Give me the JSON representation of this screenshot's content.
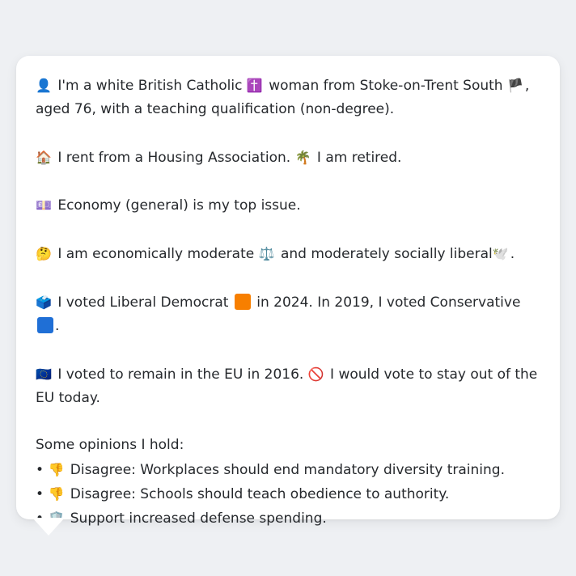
{
  "colors": {
    "background": "#eef0f3",
    "card": "#ffffff",
    "text": "#26292d",
    "lib_dem_square": "#f77f00",
    "conservative_square": "#1f6fd6"
  },
  "icons": [
    "person-icon",
    "cross-icon",
    "england-flag-icon",
    "house-icon",
    "palm-tree-icon",
    "money-icon",
    "thinking-face-icon",
    "scales-icon",
    "dove-icon",
    "ballot-box-icon",
    "orange-square-icon",
    "blue-square-icon",
    "eu-flag-icon",
    "no-entry-icon",
    "thumbs-down-icon",
    "shield-icon"
  ],
  "persona": {
    "intro_emoji": "👤",
    "intro_text_a": "I'm a white British Catholic",
    "religion_emoji": "✝️",
    "intro_text_b": "woman from Stoke-on-Trent South",
    "flag_emoji": "🏴",
    "intro_text_c": ", aged 76, with a teaching qualification (non-degree).",
    "housing_emoji": "🏠",
    "housing_text": "I rent from a Housing Association.",
    "work_emoji": "🌴",
    "work_text": "I am retired.",
    "issue_emoji": "💷",
    "issue_text": "Economy (general) is my top issue.",
    "ideology_emoji": "🤔",
    "ideology_text_a": "I am economically moderate",
    "scales_emoji": "⚖️",
    "ideology_text_b": "and moderately socially liberal",
    "dove_emoji": "🕊️",
    "ideology_text_c": ".",
    "vote_emoji": "🗳️",
    "vote_text_a": "I voted Liberal Democrat",
    "vote_text_b": "in 2024. In 2019, I voted Conservative",
    "vote_text_c": ".",
    "eu_emoji": "🇪🇺",
    "eu_text_a": "I voted to remain in the EU in 2016.",
    "no_entry_emoji": "🚫",
    "eu_text_b": "I would vote to stay out of the EU today.",
    "opinions_heading": "Some opinions I hold:",
    "opinions": [
      {
        "bullet": "•",
        "emoji": "👎",
        "text": "Disagree: Workplaces should end mandatory diversity training."
      },
      {
        "bullet": "•",
        "emoji": "👎",
        "text": "Disagree: Schools should teach obedience to authority."
      },
      {
        "bullet": "•",
        "emoji": "🛡️",
        "text": "Support increased defense spending."
      }
    ]
  }
}
